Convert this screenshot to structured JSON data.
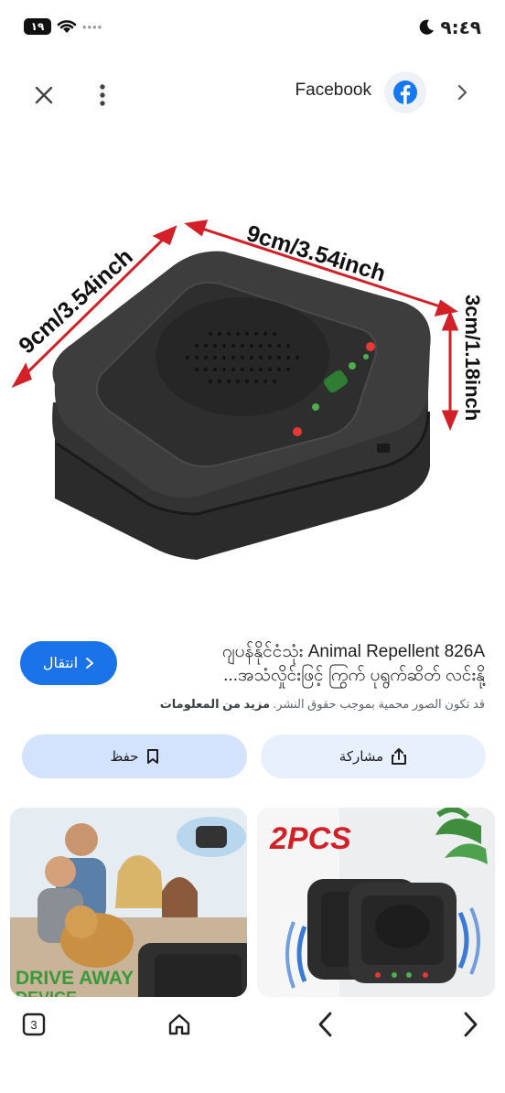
{
  "status_bar": {
    "battery": "١٩",
    "time": "٩:٤٩"
  },
  "top_bar": {
    "source": "Facebook"
  },
  "hero": {
    "dim_top": "9cm/3.54inch",
    "dim_left": "9cm/3.54inch",
    "dim_right": "3cm/1.18inch"
  },
  "result": {
    "visit_label": "انتقال",
    "title_line1": "ဂျပန်နိုင်ငံသုံး Animal Repellent 826A",
    "title_line2": "...အသံလှိုင်းဖြင့် ကြွက် ပုရွက်ဆိတ် လင်းနို့",
    "notice": "قد تكون الصور محمية بموجب حقوق النشر.",
    "notice_link": "مزيد من المعلومات"
  },
  "actions": {
    "save_label": "حفظ",
    "share_label": "مشاركة"
  },
  "thumbs": {
    "left_caption": "DRIVE AWAY",
    "left_caption2": "DEVICE",
    "right_caption": "2PCS"
  },
  "bottom_nav": {
    "tabs_count": "3"
  },
  "colors": {
    "accent": "#1a73e8",
    "save_bg": "#d3e3fd",
    "share_bg": "#e8f0fe",
    "dimension_red": "#d32027",
    "facebook_blue": "#1877f2"
  }
}
